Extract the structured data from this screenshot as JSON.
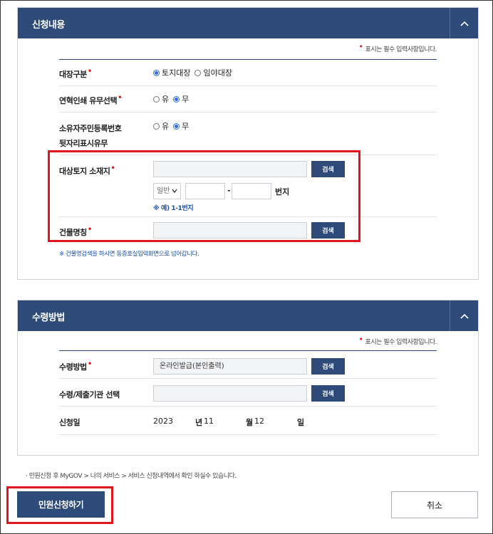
{
  "sections": {
    "apply": {
      "title": "신청내용",
      "required_note": "표시는 필수 입력사항입니다.",
      "fields": {
        "ledger_type": {
          "label": "대장구분",
          "options": [
            "토지대장",
            "임야대장"
          ],
          "selected": "토지대장"
        },
        "history_print": {
          "label": "연혁인쇄 유무선택",
          "options": [
            "유",
            "무"
          ],
          "selected": "무"
        },
        "resident_number": {
          "label_line1": "소유자주민등록번호",
          "label_line2": "뒷자리표시유무",
          "options": [
            "유",
            "무"
          ],
          "selected": "무"
        },
        "land_location": {
          "label": "대상토지 소재지",
          "search_label": "검색",
          "lot_type": "일반",
          "hyphen": "-",
          "lot_suffix": "번지",
          "example": "※ 예) 1-1번지"
        },
        "building_name": {
          "label": "건물명칭",
          "search_label": "검색"
        }
      },
      "building_note": "※ 건물명검색을 하시면 동층호실입력화면으로 넘어갑니다."
    },
    "receive": {
      "title": "수령방법",
      "required_note": "표시는 필수 입력사항입니다.",
      "fields": {
        "method": {
          "label": "수령방법",
          "value": "온라인발급(본인출력)",
          "search_label": "검색"
        },
        "agency": {
          "label": "수령/제출기관 선택",
          "search_label": "검색"
        },
        "date": {
          "label": "신청일",
          "year": "2023",
          "year_unit": "년",
          "month": "11",
          "month_unit": "월",
          "day": "12",
          "day_unit": "일"
        }
      }
    }
  },
  "bottom_note": "· 민원신청 후 MyGOV > 나의 서비스 > 서비스 신청내역에서 확인 하실수 있습니다.",
  "buttons": {
    "submit": "민원신청하기",
    "cancel": "취소"
  },
  "colors": {
    "header": "#2e4a78",
    "required": "#e5161b",
    "highlight": "#e0161c",
    "radio_on": "#2f6fd6"
  },
  "icons": {
    "collapse": "chevron-up-icon",
    "dropdown": "chevron-down-icon"
  }
}
